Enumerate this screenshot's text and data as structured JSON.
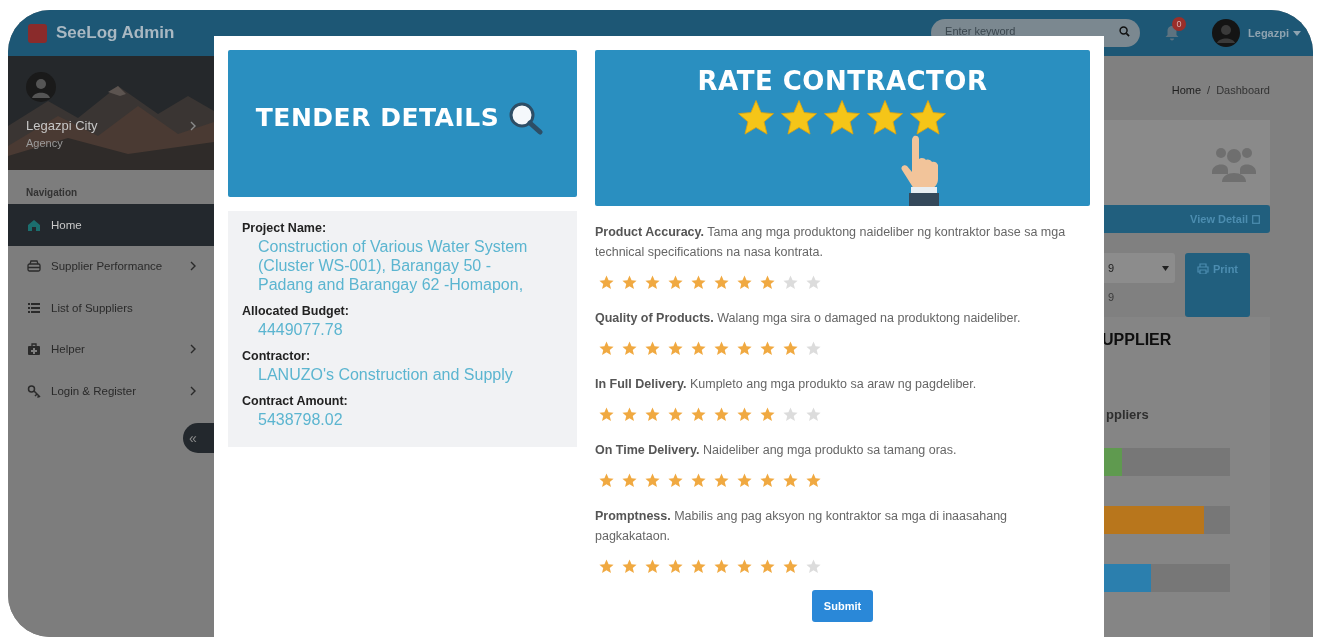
{
  "app": {
    "brand": "SeeLog Admin",
    "search": {
      "placeholder": "Enter keyword"
    },
    "notifications": "0",
    "user": "Legazpi"
  },
  "sidebar": {
    "profile": {
      "name": "Legazpi City",
      "role": "Agency"
    },
    "section": "Navigation",
    "items": [
      {
        "label": "Home",
        "selected": true,
        "has_submenu": false
      },
      {
        "label": "Supplier Performance",
        "selected": false,
        "has_submenu": true
      },
      {
        "label": "List of Suppliers",
        "selected": false,
        "has_submenu": false
      },
      {
        "label": "Helper",
        "selected": false,
        "has_submenu": true
      },
      {
        "label": "Login & Register",
        "selected": false,
        "has_submenu": true
      }
    ],
    "collapse": "«"
  },
  "content": {
    "breadcrumb": [
      "Home",
      "Dashboard"
    ],
    "breadcrumb_separator": "/",
    "view_detail": "View Detail",
    "select_value": "9",
    "select_note": "9",
    "print": "Print",
    "panel_title": "UPPLIER",
    "panel_subtitle": "ppliers",
    "bars": [
      {
        "level": 0.14,
        "color": "#5f9a4f"
      },
      {
        "level": 0.79,
        "color": "#b8761c"
      },
      {
        "level": 0.37,
        "color": "#2b7fae"
      }
    ]
  },
  "modal": {
    "tender": {
      "banner": "TENDER DETAILS",
      "fields": [
        {
          "label": "Project Name:",
          "value": "Construction of Various Water System (Cluster WS-001), Barangay 50 - Padang and Barangay 62 -Homapon,"
        },
        {
          "label": "Allocated Budget:",
          "value": "4449077.78"
        },
        {
          "label": "Contractor:",
          "value": "LANUZO's Construction and Supply"
        },
        {
          "label": "Contract Amount:",
          "value": "5438798.02"
        }
      ]
    },
    "rating": {
      "banner": "RATE CONTRACTOR",
      "criteria": [
        {
          "text": "**Product Accuracy.** Tama ang mga produktong naideliber ng kontraktor base sa mga technical specifications na nasa kontrata.",
          "stars": 8
        },
        {
          "text": "**Quality of Products.** Walang mga sira o damaged na produktong naideliber.",
          "stars": 9
        },
        {
          "text": "**In Full Delivery.** Kumpleto ang mga produkto sa araw ng pagdeliber.",
          "stars": 8
        },
        {
          "text": "**On Time Delivery.** Naideliber ang mga produkto sa tamang oras.",
          "stars": 10
        },
        {
          "text": "**Promptness.** Mabilis ang pag aksyon ng kontraktor sa mga di inaasahang pagkakataon.",
          "stars": 9
        }
      ],
      "submit": "Submit"
    }
  }
}
